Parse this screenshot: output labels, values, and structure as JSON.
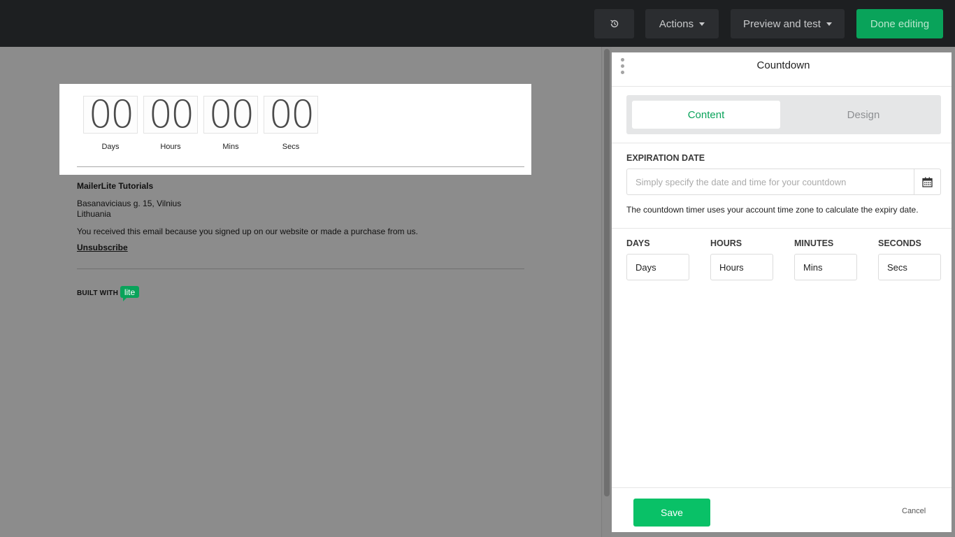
{
  "toolbar": {
    "undo_icon": "history-icon",
    "actions_label": "Actions",
    "preview_label": "Preview and test",
    "done_label": "Done editing"
  },
  "email": {
    "countdown": [
      {
        "value": "00",
        "label": "Days"
      },
      {
        "value": "00",
        "label": "Hours"
      },
      {
        "value": "00",
        "label": "Mins"
      },
      {
        "value": "00",
        "label": "Secs"
      }
    ],
    "footer": {
      "company": "MailerLite Tutorials",
      "address_line1": "Basanaviciaus g. 15, Vilnius",
      "address_line2": "Lithuania",
      "reason": "You received this email because you signed up on our website or made a purchase from us.",
      "unsubscribe": "Unsubscribe",
      "built_with": "BUILT WITH",
      "badge": "lite"
    }
  },
  "panel": {
    "title": "Countdown",
    "tabs": [
      {
        "label": "Content",
        "active": true
      },
      {
        "label": "Design",
        "active": false
      }
    ],
    "expiration": {
      "label": "EXPIRATION DATE",
      "placeholder": "Simply specify the date and time for your countdown",
      "value": "",
      "calendar_icon": "calendar-icon",
      "note": "The countdown timer uses your account time zone to calculate the expiry date."
    },
    "units": [
      {
        "label": "DAYS",
        "value": "Days"
      },
      {
        "label": "HOURS",
        "value": "Hours"
      },
      {
        "label": "MINUTES",
        "value": "Mins"
      },
      {
        "label": "SECONDS",
        "value": "Secs"
      }
    ],
    "save_label": "Save",
    "cancel_label": "Cancel"
  },
  "colors": {
    "accent": "#09a35a",
    "save": "#09c167",
    "topbar": "#1d1f21",
    "canvas": "#8c8c8c"
  }
}
